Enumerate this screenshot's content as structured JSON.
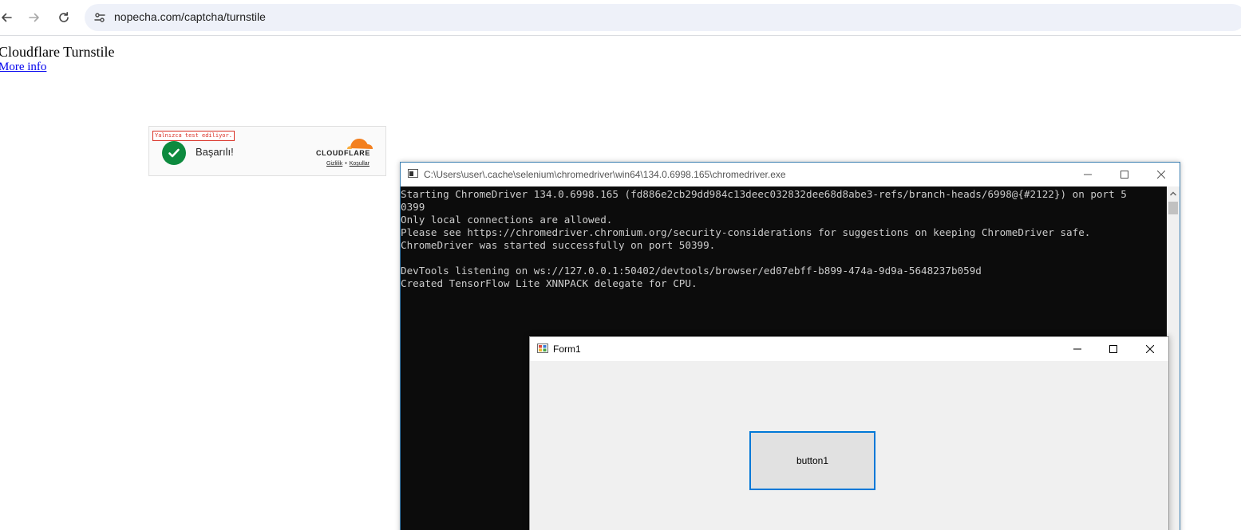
{
  "browser": {
    "url": "nopecha.com/captcha/turnstile",
    "back_icon": "arrow-left-icon",
    "forward_icon": "arrow-right-icon",
    "reload_icon": "reload-icon",
    "site_info_icon": "tune-icon"
  },
  "page": {
    "title": "Cloudflare Turnstile",
    "more_info_link": "More info"
  },
  "turnstile": {
    "test_banner": "Yalnızca test ediliyor.",
    "status_text": "Başarılı!",
    "brand": "CLOUDFLARE",
    "privacy_link": "Gizlilik",
    "separator": "•",
    "terms_link": "Koşullar",
    "colors": {
      "success": "#0d8a3e",
      "cloud": "#f38020"
    }
  },
  "console_window": {
    "title": "C:\\Users\\user\\.cache\\selenium\\chromedriver\\win64\\134.0.6998.165\\chromedriver.exe",
    "lines": [
      "Starting ChromeDriver 134.0.6998.165 (fd886e2cb29dd984c13deec032832dee68d8abe3-refs/branch-heads/6998@{#2122}) on port 5",
      "0399",
      "Only local connections are allowed.",
      "Please see https://chromedriver.chromium.org/security-considerations for suggestions on keeping ChromeDriver safe.",
      "ChromeDriver was started successfully on port 50399.",
      "",
      "DevTools listening on ws://127.0.0.1:50402/devtools/browser/ed07ebff-b899-474a-9d9a-5648237b059d",
      "Created TensorFlow Lite XNNPACK delegate for CPU."
    ]
  },
  "form_window": {
    "title": "Form1",
    "button_label": "button1"
  }
}
